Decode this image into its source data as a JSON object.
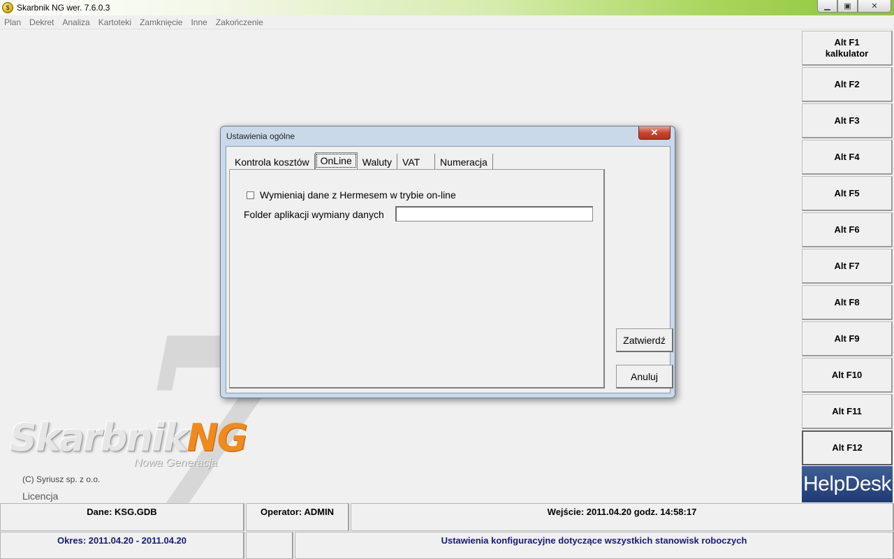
{
  "window": {
    "title": "Skarbnik NG wer. 7.6.0.3",
    "app_icon": "$",
    "minimize": "▁",
    "maximize": "▣",
    "close": "✕"
  },
  "menu": [
    "Plan",
    "Dekret",
    "Analiza",
    "Kartoteki",
    "Zamknięcie",
    "Inne",
    "Zakończenie"
  ],
  "shortcuts": [
    {
      "line1": "Alt F1",
      "line2": "kalkulator"
    },
    {
      "line1": "Alt F2",
      "line2": ""
    },
    {
      "line1": "Alt F3",
      "line2": ""
    },
    {
      "line1": "Alt F4",
      "line2": ""
    },
    {
      "line1": "Alt F5",
      "line2": ""
    },
    {
      "line1": "Alt F6",
      "line2": ""
    },
    {
      "line1": "Alt F7",
      "line2": ""
    },
    {
      "line1": "Alt F8",
      "line2": ""
    },
    {
      "line1": "Alt F9",
      "line2": ""
    },
    {
      "line1": "Alt F10",
      "line2": ""
    },
    {
      "line1": "Alt F11",
      "line2": ""
    },
    {
      "line1": "Alt F12",
      "line2": ""
    }
  ],
  "helpdesk": "HelpDesk",
  "branding": {
    "seven": "7",
    "logo_main": "Skarbnik",
    "logo_ng": "NG",
    "logo_sub": "Nowa Generacja",
    "copyright": "(C) Syriusz sp. z o.o.",
    "licencja": "Licencja"
  },
  "status": {
    "dane": "Dane: KSG.GDB",
    "operator": "Operator: ADMIN",
    "wejscie": "Wejście: 2011.04.20 godz. 14:58:17",
    "okres": "Okres: 2011.04.20 - 2011.04.20",
    "empty": "",
    "opis": "Ustawienia konfiguracyjne dotyczące wszystkich stanowisk roboczych"
  },
  "dialog": {
    "title": "Ustawienia ogólne",
    "close": "✕",
    "tabs": [
      "Kontrola kosztów",
      "OnLine",
      "Waluty",
      "VAT",
      "Numeracja"
    ],
    "selected_tab": "OnLine",
    "checkbox_label": "Wymieniaj dane z Hermesem w trybie on-line",
    "checkbox_checked": false,
    "folder_label": "Folder aplikacji wymiany danych",
    "folder_value": "",
    "confirm": "Zatwierdź",
    "cancel": "Anuluj"
  }
}
